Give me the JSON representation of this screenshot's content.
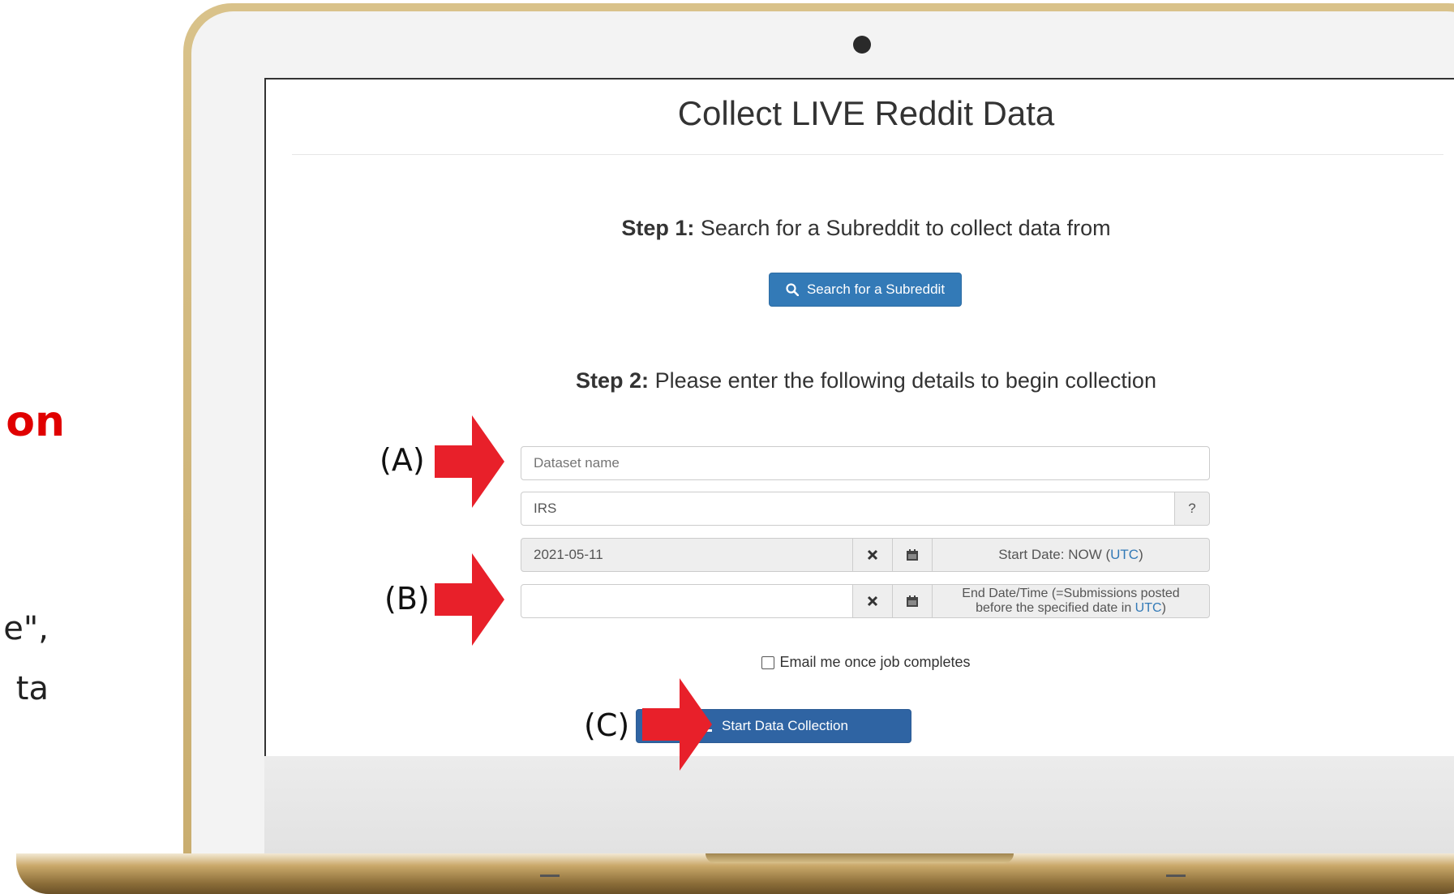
{
  "slide": {
    "heading_fragment": "on",
    "line1_fragment": "e\",",
    "line2_fragment": "ta"
  },
  "page": {
    "title": "Collect LIVE Reddit Data",
    "step1": {
      "label": "Step 1:",
      "text": " Search for a Subreddit to collect data from"
    },
    "search_button": "Search for a Subreddit",
    "step2": {
      "label": "Step 2:",
      "text": " Please enter the following details to begin collection"
    },
    "dataset_name": {
      "value": "",
      "placeholder": "Dataset name"
    },
    "subreddit": {
      "value": "IRS",
      "help": "?"
    },
    "start_date": {
      "value": "2021-05-11",
      "label_prefix": "Start Date: NOW (",
      "label_link": "UTC",
      "label_suffix": ")"
    },
    "end_date": {
      "value": "",
      "label_line1": "End Date/Time (=Submissions posted",
      "label_line2_prefix": "before the specified date in ",
      "label_link": "UTC",
      "label_suffix": ")"
    },
    "email_checkbox": {
      "label": "Email me once job completes",
      "checked": false
    },
    "start_button": "Start Data Collection"
  },
  "annotations": {
    "a": "(A)",
    "b": "(B)",
    "c": "(C)",
    "arrow_color": "#e8202a"
  },
  "icons": [
    "search-icon",
    "clear-icon",
    "calendar-icon",
    "download-icon"
  ],
  "colors": {
    "primary": "#337ab7",
    "laptop_gold": "#c9ad6f",
    "heading_red": "#e00000"
  }
}
